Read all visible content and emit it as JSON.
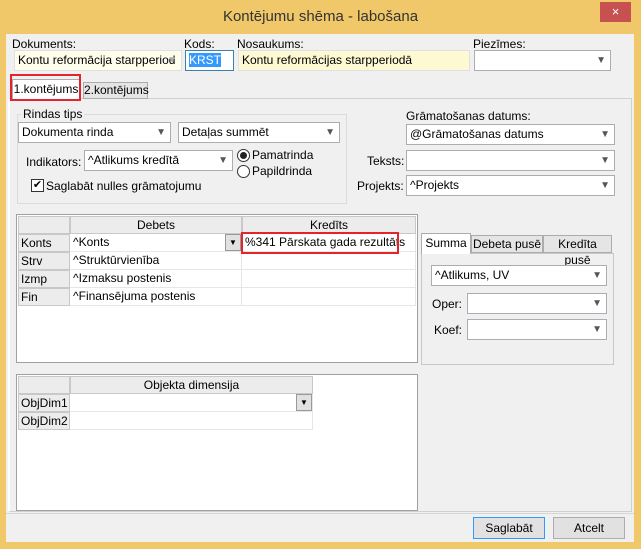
{
  "window": {
    "title": "Kontējumu shēma - labošana",
    "close_icon": "×"
  },
  "header": {
    "dokuments_label": "Dokuments:",
    "dokuments_value": "Kontu reformācija starpperiod",
    "kods_label": "Kods:",
    "kods_value": "KRST",
    "nosaukums_label": "Nosaukums:",
    "nosaukums_value": "Kontu reformācijas starpperiodā",
    "piezimes_label": "Piezīmes:",
    "piezimes_value": ""
  },
  "tabs": [
    {
      "label": "1.kontējums"
    },
    {
      "label": "2.kontējums"
    }
  ],
  "rindas": {
    "group_label": "Rindas tips",
    "type_value": "Dokumenta rinda",
    "sum_value": "Detaļas summēt",
    "indikators_label": "Indikators:",
    "indikators_value": "^Atlikums kredītā",
    "radio1": "Pamatrinda",
    "radio2": "Papildrinda",
    "checkbox_label": "Saglabāt nulles grāmatojumu",
    "checkbox_checked": true
  },
  "right": {
    "datums_label": "Grāmatošanas datums:",
    "datums_value": "@Grāmatošanas datums",
    "teksts_label": "Teksts:",
    "teksts_value": "",
    "projekts_label": "Projekts:",
    "projekts_value": "^Projekts"
  },
  "grid": {
    "headers": [
      "Debets",
      "Kredīts"
    ],
    "rows": [
      {
        "label": "Konts",
        "debets": "^Konts",
        "kredits": "%341 Pārskata gada rezultāts"
      },
      {
        "label": "Strv",
        "debets": "^Struktūrvienība",
        "kredits": ""
      },
      {
        "label": "Izmp",
        "debets": "^Izmaksu postenis",
        "kredits": ""
      },
      {
        "label": "Fin",
        "debets": "^Finansējuma postenis",
        "kredits": ""
      }
    ]
  },
  "sum_tabs": [
    {
      "label": "Summa"
    },
    {
      "label": "Debeta pusē"
    },
    {
      "label": "Kredīta pusē"
    }
  ],
  "sum": {
    "value": "^Atlikums, UV",
    "oper_label": "Oper:",
    "koef_label": "Koef:"
  },
  "objgrid": {
    "header": "Objekta dimensija",
    "rows": [
      {
        "label": "ObjDim1",
        "value": ""
      },
      {
        "label": "ObjDim2",
        "value": ""
      }
    ]
  },
  "buttons": {
    "save": "Saglabāt",
    "cancel": "Atcelt"
  }
}
